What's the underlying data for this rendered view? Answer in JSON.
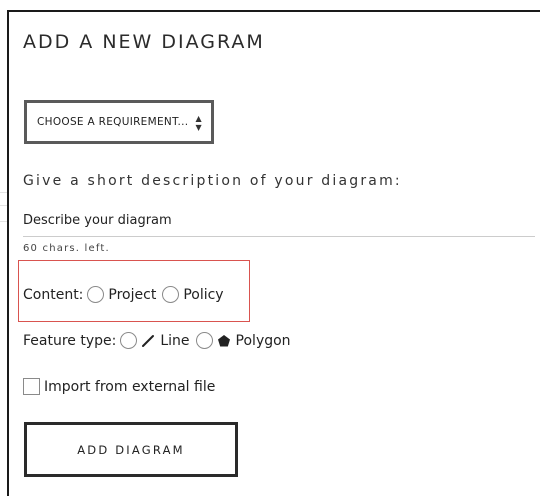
{
  "panel": {
    "title": "ADD A NEW DIAGRAM"
  },
  "requirement_select": {
    "selected_label": "CHOOSE A REQUIREMENT..."
  },
  "description": {
    "label": "Give a short description of your diagram:",
    "placeholder": "Describe your diagram",
    "value": "",
    "chars_left": "60 chars. left."
  },
  "content": {
    "label": "Content:",
    "options": [
      "Project",
      "Policy"
    ]
  },
  "feature_type": {
    "label": "Feature type:",
    "options": [
      {
        "label": "Line",
        "icon": "line-icon"
      },
      {
        "label": "Polygon",
        "icon": "polygon-icon"
      }
    ]
  },
  "import": {
    "label": "Import from external file",
    "checked": false
  },
  "submit": {
    "label": "ADD DIAGRAM"
  },
  "colors": {
    "highlight_border": "#d9534f",
    "frame": "#1a1a1a"
  }
}
